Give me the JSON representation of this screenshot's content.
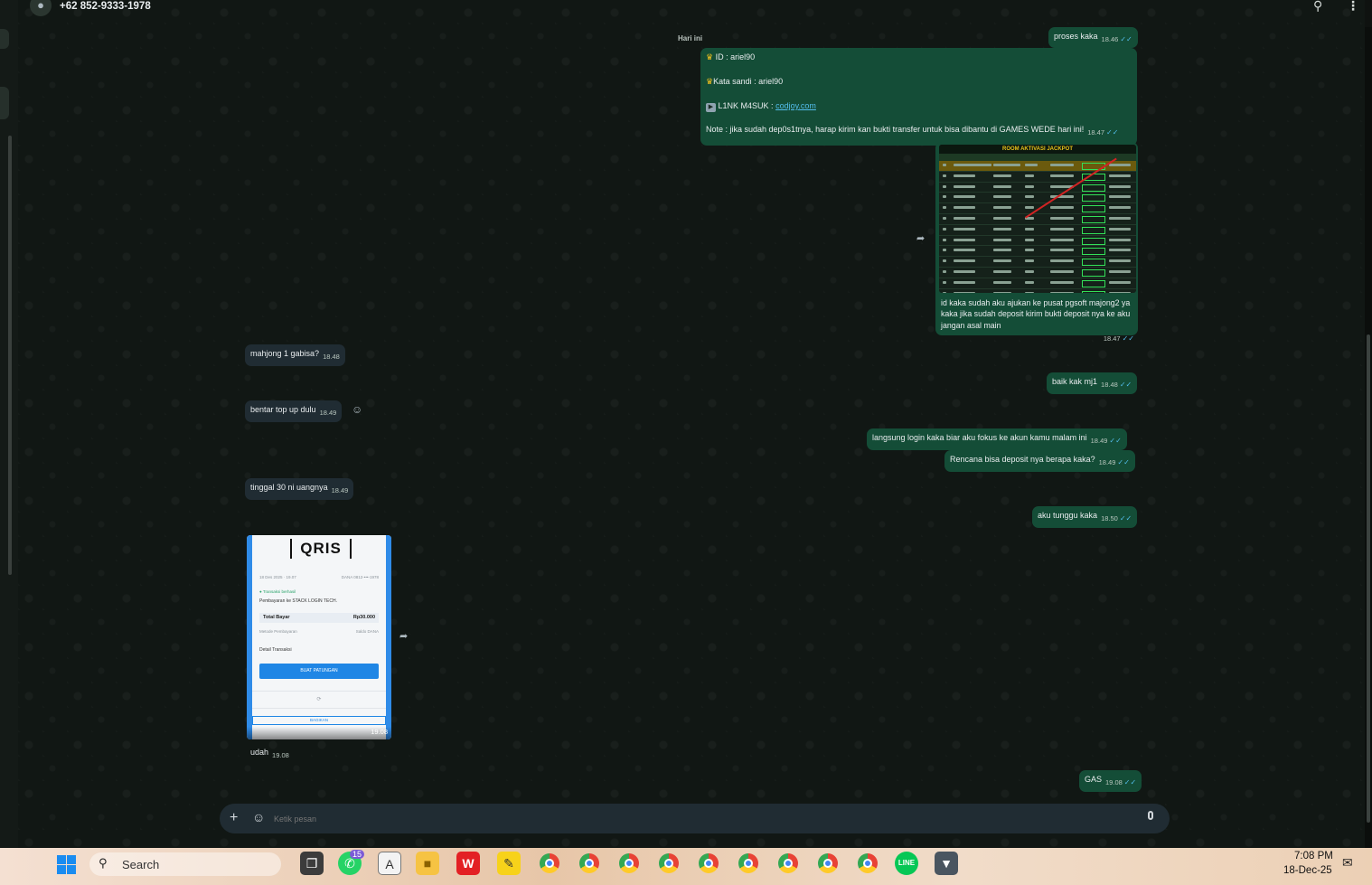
{
  "header": {
    "contact": "+62 852-9333-1978",
    "avatar_icon": "person-icon",
    "search_icon": "search-icon",
    "menu_icon": "more-vertical-icon"
  },
  "day_label": "Hari ini",
  "messages": {
    "m1": {
      "text": "proses kaka",
      "time": "18.46"
    },
    "m2": {
      "line1_label": "ID :",
      "line1_value": "ariel90",
      "line2": "Kata sandi : ariel90",
      "line3_label": "L1NK M4SUK :",
      "line3_link": "codjoy.com",
      "note": "Note : jika sudah dep0s1tnya, harap kirim kan bukti transfer untuk bisa dibantu di GAMES WEDE hari ini!",
      "time": "18.47"
    },
    "m3": {
      "image_title": "ROOM AKTIVASI JACKPOT",
      "caption": "id kaka sudah aku ajukan ke pusat pgsoft majong2 ya kaka jika sudah deposit kirim bukti deposit nya ke aku jangan asal main",
      "time": "18.47"
    },
    "m4": {
      "text": "mahjong 1 gabisa?",
      "time": "18.48"
    },
    "m5": {
      "text": "baik kak mj1",
      "time": "18.48"
    },
    "m6": {
      "text": "bentar top up dulu",
      "time": "18.49"
    },
    "m7": {
      "text": "langsung login kaka biar aku fokus ke akun kamu malam ini",
      "time": "18.49"
    },
    "m8": {
      "text": "Rencana bisa deposit nya berapa kaka?",
      "time": "18.49"
    },
    "m9": {
      "text": "tinggal 30 ni uangnya",
      "time": "18.49"
    },
    "m10": {
      "text": "aku tunggu kaka",
      "time": "18.50"
    },
    "m11": {
      "logo": "QRIS",
      "top_date": "18 Des 2025 · 19.07",
      "top_account": "DANA 0812-•••-1978",
      "status": "Transaksi berhasil",
      "merchant": "Pembayaran ke STACK LOGIN TECH.",
      "total_label": "Total Bayar",
      "total_value": "Rp30.000",
      "method_label": "Metode Pembayaran",
      "method_value": "Saldo DANA",
      "detail_label": "Detail Transaksi",
      "button": "BUAT PATUNGAN",
      "share": "BAGIKAN",
      "time": "19.08"
    },
    "m12": {
      "text": "udah",
      "time": "19.08"
    },
    "m13": {
      "text": "GAS",
      "time": "19.08"
    }
  },
  "composer": {
    "placeholder": "Ketik pesan",
    "add_icon": "plus-icon",
    "emoji_icon": "emoji-icon",
    "mic_icon": "mic-icon"
  },
  "taskbar": {
    "search": "Search",
    "whatsapp_badge": "15",
    "time": "7:08 PM",
    "date": "18-Dec-25",
    "notepad_glyph": "A"
  },
  "colors": {
    "incoming": "#202c33",
    "outgoing": "#144d37",
    "link": "#53bdeb",
    "tick": "#53bdeb"
  }
}
